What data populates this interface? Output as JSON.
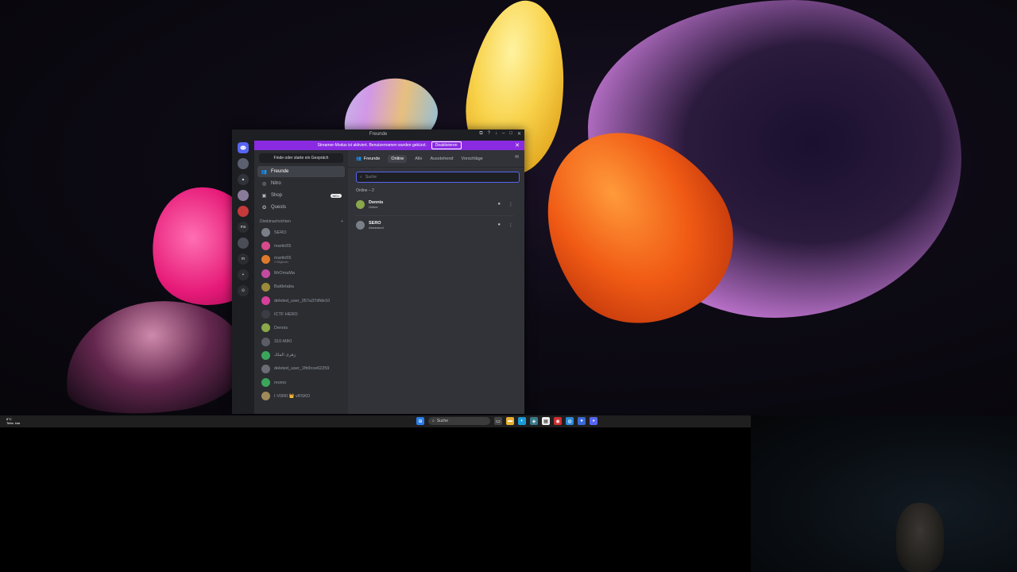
{
  "window": {
    "title": "Freunde",
    "controls": [
      "⧉",
      "?",
      "↓",
      "–",
      "□",
      "✕"
    ]
  },
  "banner": {
    "text": "Streamer-Modus ist aktiviert. Benutzernamen wurden gekürzt.",
    "button": "Deaktivieren"
  },
  "servers": [
    "",
    "",
    "▲",
    "",
    "",
    "ms",
    "",
    "m",
    "+",
    "⊙"
  ],
  "sidebar": {
    "find_label": "Finde oder starte ein Gespräch",
    "nav": [
      {
        "label": "Freunde",
        "icon": "friends-icon",
        "badge": ""
      },
      {
        "label": "Nitro",
        "icon": "nitro-icon",
        "badge": ""
      },
      {
        "label": "Shop",
        "icon": "shop-icon",
        "badge": "NEU"
      },
      {
        "label": "Quests",
        "icon": "quests-icon",
        "badge": ""
      }
    ],
    "dm_header": "Direktnachrichten",
    "dm_add": "+",
    "dms": [
      {
        "name": "SERO",
        "sub": "",
        "color": "#7a7f88"
      },
      {
        "name": "martin55",
        "sub": "",
        "color": "#d84a8a"
      },
      {
        "name": "martin55",
        "sub": "2 Mitglieder",
        "color": "#e07a2a"
      },
      {
        "name": "MrOmaMa",
        "sub": "",
        "color": "#c24aa0"
      },
      {
        "name": "Battletaba",
        "sub": "",
        "color": "#9a8a3a"
      },
      {
        "name": "deleted_user_057a37dfde10",
        "sub": "",
        "color": "#d63f9a"
      },
      {
        "name": "ICTF HERO",
        "sub": "",
        "color": "#3a3d44"
      },
      {
        "name": "Dennis",
        "sub": "",
        "color": "#8aa84a"
      },
      {
        "name": "310-MIKI",
        "sub": "",
        "color": "#5a5d66"
      },
      {
        "name": "زهرى الملك",
        "sub": "",
        "color": "#3ba55c"
      },
      {
        "name": "deleted_user_1fb9cce62259",
        "sub": "",
        "color": "#6a6d76"
      },
      {
        "name": "momo",
        "sub": "",
        "color": "#3ba55c"
      },
      {
        "name": "I·V0R0 👑 vRSKD",
        "sub": "",
        "color": "#a08a5a"
      }
    ]
  },
  "main": {
    "tabs": {
      "friends": "Freunde",
      "online": "Online",
      "all": "Alle",
      "pending": "Ausstehend",
      "suggestions": "Vorschläge"
    },
    "search_placeholder": "Suche",
    "online_header": "Online – 2",
    "friends": [
      {
        "name": "Dennis",
        "status": "Online",
        "color": "#8aa84a"
      },
      {
        "name": "SERO",
        "status": "Abwesend",
        "color": "#7a7f88"
      }
    ]
  },
  "taskbar": {
    "weather_temp": "8°C",
    "weather_desc": "Teilw. klar",
    "search_label": "Suche"
  }
}
